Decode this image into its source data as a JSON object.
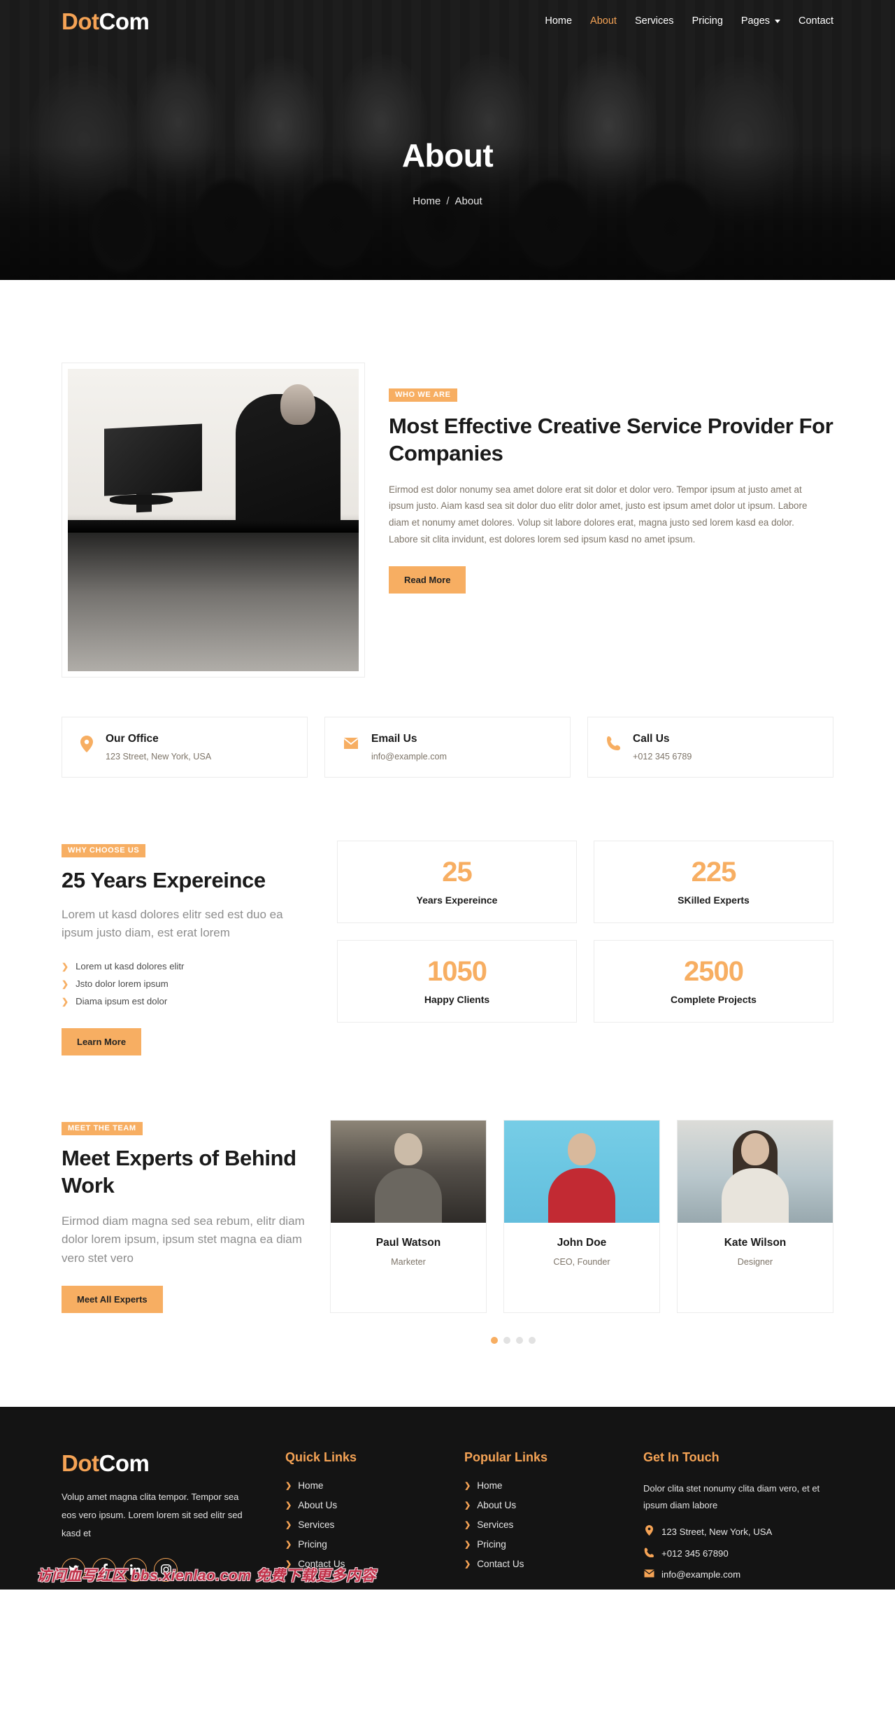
{
  "brand": {
    "part1": "Dot",
    "part2": "Com"
  },
  "colors": {
    "accent": "#F7AE62",
    "accent_logo": "#F5A355",
    "dark": "#141414",
    "text": "#7d7468"
  },
  "nav": {
    "items": [
      {
        "label": "Home",
        "active": false,
        "caret": false
      },
      {
        "label": "About",
        "active": true,
        "caret": false
      },
      {
        "label": "Services",
        "active": false,
        "caret": false
      },
      {
        "label": "Pricing",
        "active": false,
        "caret": false
      },
      {
        "label": "Pages",
        "active": false,
        "caret": true
      },
      {
        "label": "Contact",
        "active": false,
        "caret": false
      }
    ]
  },
  "hero": {
    "title": "About",
    "breadcrumb_home": "Home",
    "breadcrumb_sep": "/",
    "breadcrumb_current": "About"
  },
  "about": {
    "tag": "WHO WE ARE",
    "heading": "Most Effective Creative Service Provider For Companies",
    "paragraph": "Eirmod est dolor nonumy sea amet dolore erat sit dolor et dolor vero. Tempor ipsum at justo amet at ipsum justo. Aiam kasd sea sit dolor duo elitr dolor amet, justo est ipsum amet dolor ut ipsum. Labore diam et nonumy amet dolores. Volup sit labore dolores erat, magna justo sed lorem kasd ea dolor. Labore sit clita invidunt, est dolores lorem sed ipsum kasd no amet ipsum.",
    "button": "Read More",
    "image_alt": "businessman-at-desk-photo"
  },
  "contact_boxes": [
    {
      "icon": "location-pin-icon",
      "glyph": "◉",
      "title": "Our Office",
      "value": "123 Street, New York, USA"
    },
    {
      "icon": "envelope-icon",
      "glyph": "✉",
      "title": "Email Us",
      "value": "info@example.com"
    },
    {
      "icon": "phone-icon",
      "glyph": "☎",
      "title": "Call Us",
      "value": "+012 345 6789"
    }
  ],
  "why": {
    "tag": "WHY CHOOSE US",
    "heading": "25 Years Expereince",
    "lead": "Lorem ut kasd dolores elitr sed est duo ea ipsum justo diam, est erat lorem",
    "features": [
      "Lorem ut kasd dolores elitr",
      "Jsto dolor lorem ipsum",
      "Diama ipsum est dolor"
    ],
    "button": "Learn More",
    "stats": [
      {
        "number": "25",
        "label": "Years Expereince"
      },
      {
        "number": "225",
        "label": "SKilled Experts"
      },
      {
        "number": "1050",
        "label": "Happy Clients"
      },
      {
        "number": "2500",
        "label": "Complete Projects"
      }
    ]
  },
  "team": {
    "tag": "MEET THE TEAM",
    "heading": "Meet Experts of Behind Work",
    "lead": "Eirmod diam magna sed sea rebum, elitr diam dolor lorem ipsum, ipsum stet magna ea diam vero stet vero",
    "button": "Meet All Experts",
    "members": [
      {
        "name": "Paul Watson",
        "role": "Marketer",
        "photo": "man-with-backpack-photo"
      },
      {
        "name": "John Doe",
        "role": "CEO, Founder",
        "photo": "man-in-red-sweater-photo"
      },
      {
        "name": "Kate Wilson",
        "role": "Designer",
        "photo": "woman-long-hair-photo"
      }
    ],
    "carousel_dots": 4,
    "carousel_active": 0
  },
  "footer": {
    "brand": {
      "part1": "Dot",
      "part2": "Com"
    },
    "about_text": "Volup amet magna clita tempor. Tempor sea eos vero ipsum. Lorem lorem sit sed elitr sed kasd et",
    "social": [
      {
        "name": "twitter-icon",
        "glyph": "🐦"
      },
      {
        "name": "facebook-icon",
        "glyph": "f"
      },
      {
        "name": "linkedin-icon",
        "glyph": "in"
      },
      {
        "name": "instagram-icon",
        "glyph": "▣"
      }
    ],
    "quick_links": {
      "title": "Quick Links",
      "items": [
        "Home",
        "About Us",
        "Services",
        "Pricing",
        "Contact Us"
      ]
    },
    "popular_links": {
      "title": "Popular Links",
      "items": [
        "Home",
        "About Us",
        "Services",
        "Pricing",
        "Contact Us"
      ]
    },
    "get_in_touch": {
      "title": "Get In Touch",
      "text": "Dolor clita stet nonumy clita diam vero, et et ipsum diam labore",
      "address": "123 Street, New York, USA",
      "phone": "+012 345 67890",
      "email": "info@example.com"
    }
  },
  "watermark": {
    "text": "访问血写红区 bbs.xienlao.com 免费下载更多内容"
  }
}
